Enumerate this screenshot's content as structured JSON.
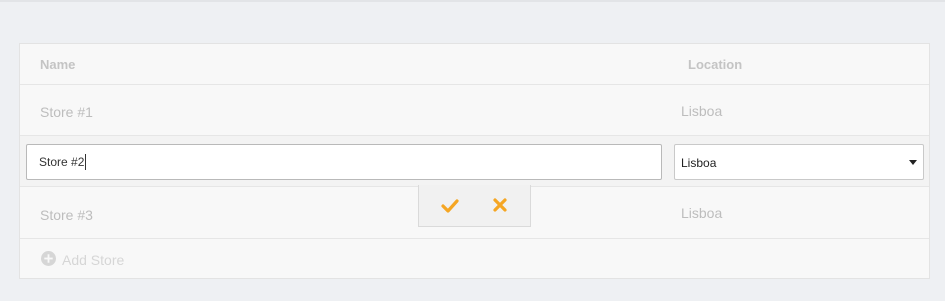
{
  "table": {
    "columns": {
      "name": "Name",
      "location": "Location"
    },
    "rows": [
      {
        "name": "Store #1",
        "location": "Lisboa"
      },
      {
        "name": "Store #3",
        "location": "Lisboa"
      }
    ],
    "editing": {
      "name_value": "Store #2",
      "location_value": "Lisboa"
    },
    "add_label": "Add Store"
  },
  "icons": {
    "confirm": "check-icon",
    "cancel": "close-icon",
    "add": "plus-circle-icon",
    "dropdown": "caret-down-icon"
  },
  "colors": {
    "accent": "#f5a623",
    "muted_text": "#bdbdbd",
    "background": "#eef0f3"
  }
}
